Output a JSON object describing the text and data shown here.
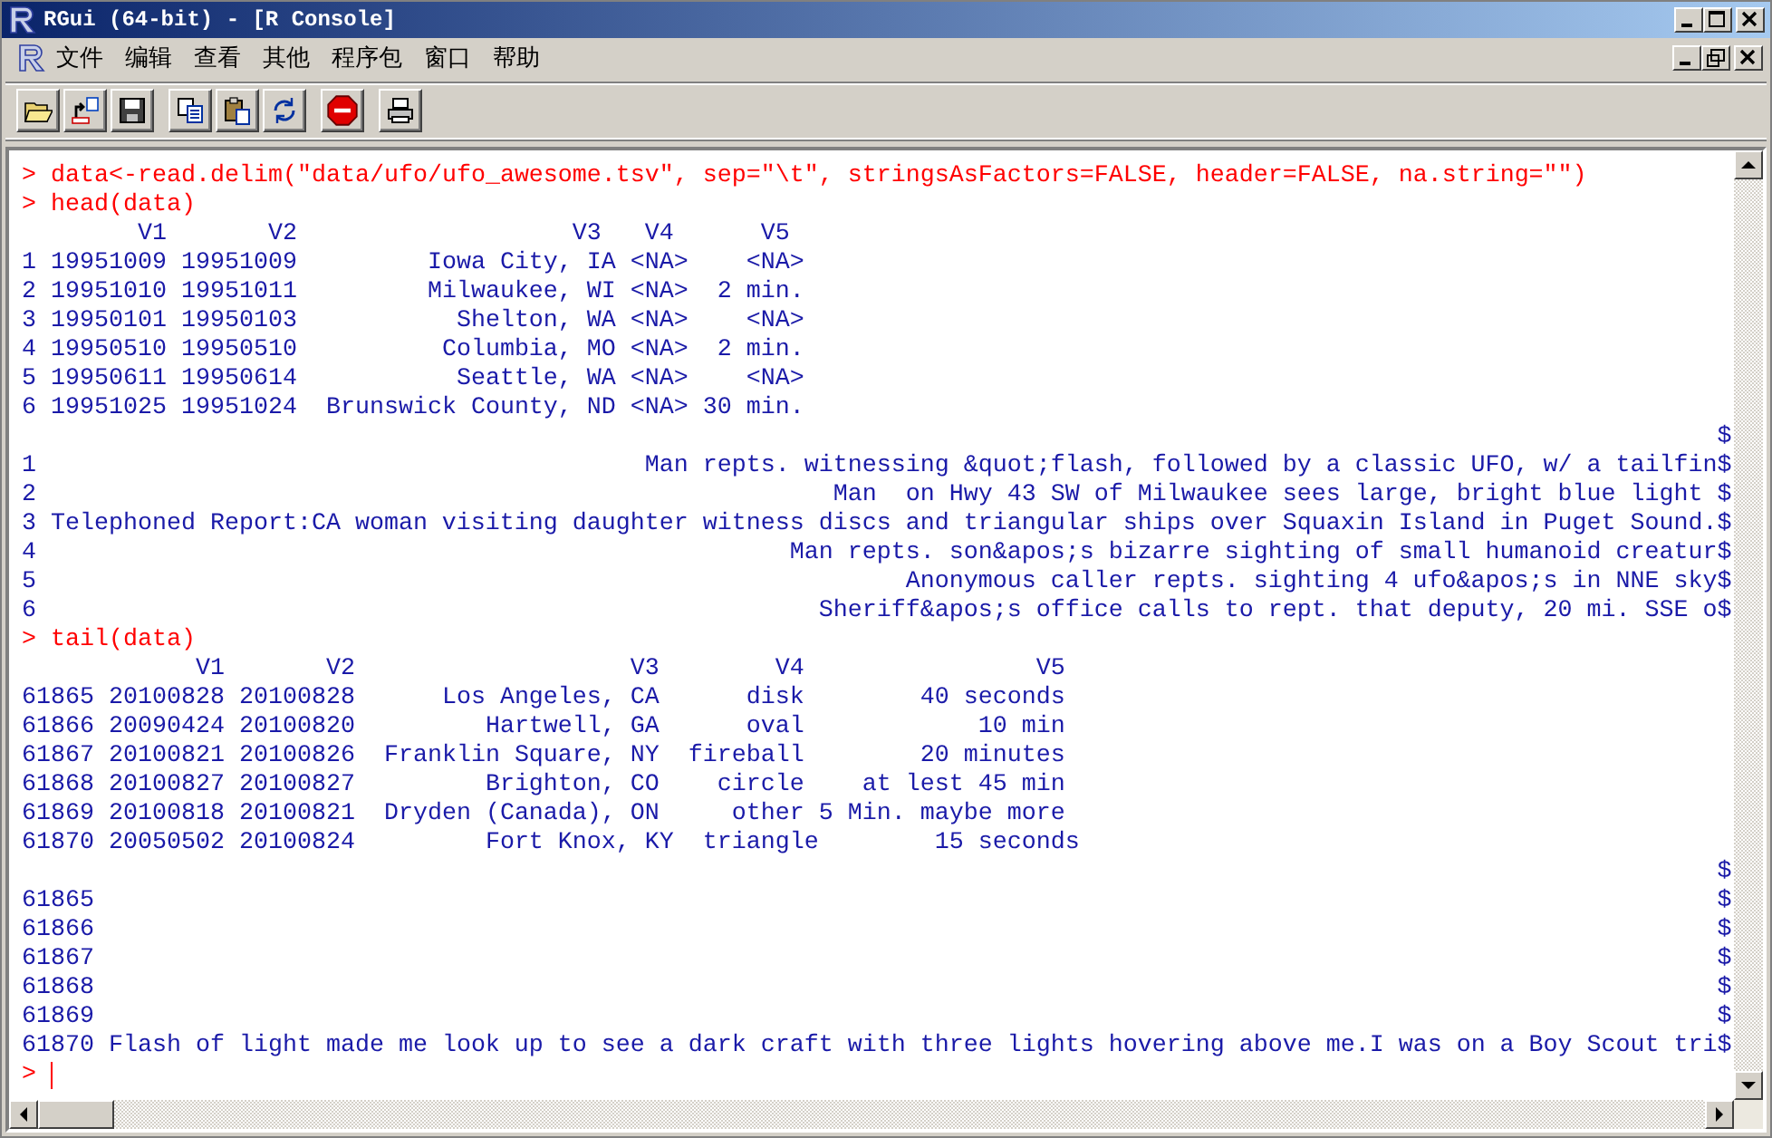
{
  "window": {
    "title": "RGui (64-bit) - [R Console]"
  },
  "menu": [
    "文件",
    "编辑",
    "查看",
    "其他",
    "程序包",
    "窗口",
    "帮助"
  ],
  "console": {
    "lines": [
      {
        "kind": "command",
        "prompt": ">",
        "text": "data<-read.delim(\"data/ufo/ufo_awesome.tsv\", sep=\"\\t\", stringsAsFactors=FALSE, header=FALSE, na.string=\"\")"
      },
      {
        "kind": "command",
        "prompt": ">",
        "text": "head(data)"
      },
      {
        "kind": "output",
        "text": "        V1       V2                   V3   V4      V5"
      },
      {
        "kind": "output",
        "text": "1 19951009 19951009         Iowa City, IA <NA>    <NA>"
      },
      {
        "kind": "output",
        "text": "2 19951010 19951011         Milwaukee, WI <NA>  2 min."
      },
      {
        "kind": "output",
        "text": "3 19950101 19950103           Shelton, WA <NA>    <NA>"
      },
      {
        "kind": "output",
        "text": "4 19950510 19950510          Columbia, MO <NA>  2 min."
      },
      {
        "kind": "output",
        "text": "5 19950611 19950614           Seattle, WA <NA>    <NA>"
      },
      {
        "kind": "output",
        "text": "6 19951025 19951024  Brunswick County, ND <NA> 30 min."
      },
      {
        "kind": "wrapped",
        "end": "$"
      },
      {
        "kind": "wrapped",
        "label": "1",
        "text": "Man repts. witnessing &quot;flash, followed by a classic UFO, w/ a tailfin",
        "end": "$"
      },
      {
        "kind": "wrapped",
        "label": "2",
        "text": "Man  on Hwy 43 SW of Milwaukee sees large, bright blue light ",
        "end": "$"
      },
      {
        "kind": "wrapped",
        "label": "3",
        "text": "Telephoned Report:CA woman visiting daughter witness discs and triangular ships over Squaxin Island in Puget Sound.",
        "end": "$"
      },
      {
        "kind": "wrapped",
        "label": "4",
        "text": "Man repts. son&apos;s bizarre sighting of small humanoid creatur",
        "end": "$"
      },
      {
        "kind": "wrapped",
        "label": "5",
        "text": "Anonymous caller repts. sighting 4 ufo&apos;s in NNE sky",
        "end": "$"
      },
      {
        "kind": "wrapped",
        "label": "6",
        "text": "Sheriff&apos;s office calls to rept. that deputy, 20 mi. SSE o",
        "end": "$"
      },
      {
        "kind": "command",
        "prompt": ">",
        "text": "tail(data)"
      },
      {
        "kind": "output",
        "text": "            V1       V2                   V3        V4                V5"
      },
      {
        "kind": "output",
        "text": "61865 20100828 20100828      Los Angeles, CA      disk        40 seconds"
      },
      {
        "kind": "output",
        "text": "61866 20090424 20100820         Hartwell, GA      oval            10 min"
      },
      {
        "kind": "output",
        "text": "61867 20100821 20100826  Franklin Square, NY  fireball        20 minutes"
      },
      {
        "kind": "output",
        "text": "61868 20100827 20100827         Brighton, CO    circle    at lest 45 min"
      },
      {
        "kind": "output",
        "text": "61869 20100818 20100821  Dryden (Canada), ON     other 5 Min. maybe more"
      },
      {
        "kind": "output",
        "text": "61870 20050502 20100824         Fort Knox, KY  triangle        15 seconds"
      },
      {
        "kind": "wrapped",
        "end": "$"
      },
      {
        "kind": "wrapped",
        "label": "61865",
        "end": "$"
      },
      {
        "kind": "wrapped",
        "label": "61866",
        "end": "$"
      },
      {
        "kind": "wrapped",
        "label": "61867",
        "end": "$"
      },
      {
        "kind": "wrapped",
        "label": "61868",
        "end": "$"
      },
      {
        "kind": "wrapped",
        "label": "61869",
        "end": "$"
      },
      {
        "kind": "wrapped",
        "label": "61870",
        "text": "Flash of light made me look up to see a dark craft with three lights hovering above me.I was on a Boy Scout tri",
        "end": "$"
      },
      {
        "kind": "prompt",
        "prompt": ">"
      }
    ]
  }
}
